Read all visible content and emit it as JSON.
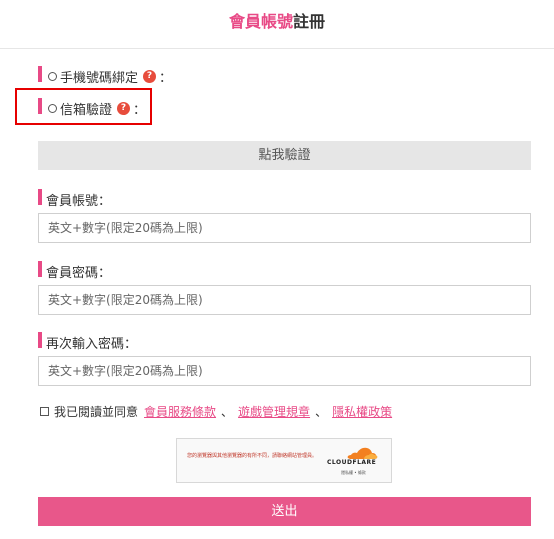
{
  "header": {
    "title_pink": "會員帳號",
    "title_dark": "註冊"
  },
  "options": [
    {
      "label": "手機號碼綁定",
      "help": "?",
      "suffix": "："
    },
    {
      "label": "信箱驗證",
      "help": "?",
      "suffix": "："
    }
  ],
  "verify_button": "點我驗證",
  "fields": [
    {
      "label": "會員帳號：",
      "placeholder": "英文+數字(限定20碼為上限)"
    },
    {
      "label": "會員密碼：",
      "placeholder": "英文+數字(限定20碼為上限)"
    },
    {
      "label": "再次輸入密碼：",
      "placeholder": "英文+數字(限定20碼為上限)"
    }
  ],
  "agree": {
    "prefix": "我已閱讀並同意",
    "link1": "會員服務條款",
    "sep1": "、",
    "link2": "遊戲管理規章",
    "sep2": "、",
    "link3": "隱私權政策"
  },
  "captcha": {
    "message": "您的瀏覽器與其他瀏覽器的有所不同，請聯絡網站管理員。",
    "brand": "CLOUDFLARE",
    "links": "隱私權 • 條款"
  },
  "submit_button": "送出",
  "colors": {
    "accent": "#e84a86",
    "highlight": "#e60000"
  }
}
